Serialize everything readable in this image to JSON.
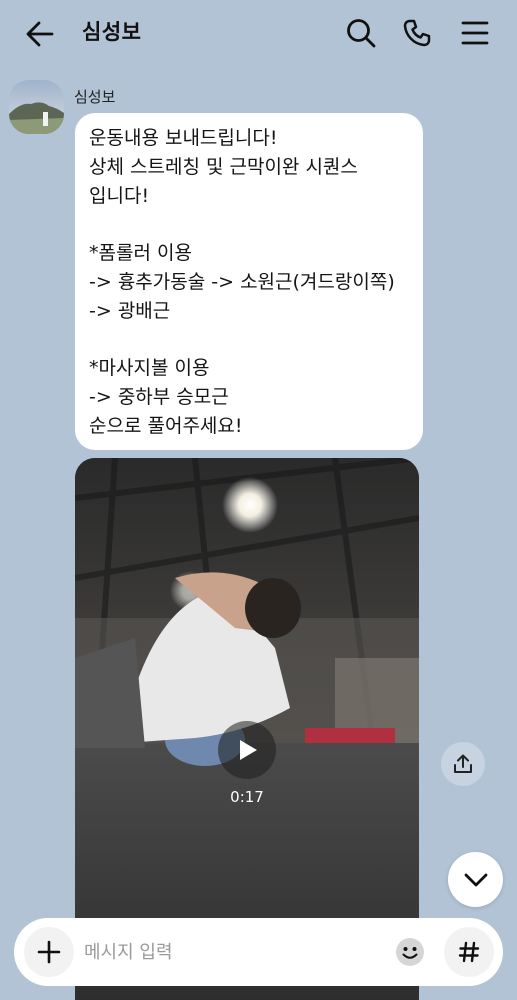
{
  "header": {
    "title": "심성보",
    "back_icon": "arrow-left-icon",
    "search_icon": "search-icon",
    "call_icon": "phone-icon",
    "menu_icon": "hamburger-menu-icon"
  },
  "message": {
    "sender": "심성보",
    "lines": [
      "운동내용 보내드립니다!",
      "상체 스트레칭 및 근막이완 시퀀스",
      "입니다!",
      "",
      "*폼롤러 이용",
      "-> 흉추가동술 -> 소원근(겨드랑이쪽)",
      "-> 광배근",
      "",
      "*마사지볼 이용",
      "-> 중하부 승모근",
      "순으로 풀어주세요!"
    ]
  },
  "video": {
    "duration": "0:17",
    "play_icon": "play-icon"
  },
  "share_icon": "share-upload-icon",
  "scroll_icon": "chevron-down-icon",
  "input": {
    "placeholder": "메시지 입력",
    "plus_icon": "plus-icon",
    "emoji_icon": "emoji-icon",
    "hash_icon": "hashtag-icon"
  },
  "colors": {
    "background": "#b2c3d6",
    "bubble": "#ffffff"
  }
}
